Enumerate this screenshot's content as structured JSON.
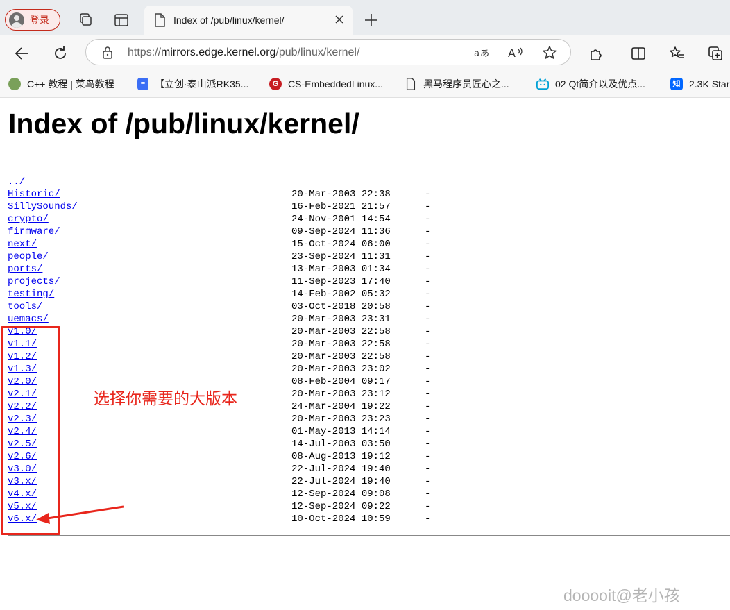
{
  "browser": {
    "profile_label": "登录",
    "tab": {
      "title": "Index of /pub/linux/kernel/"
    },
    "address": {
      "scheme": "https://",
      "host": "mirrors.edge.kernel.org",
      "path": "/pub/linux/kernel/"
    }
  },
  "favorites": [
    {
      "label": "C++ 教程 | 菜鸟教程",
      "icon": "runoob-icon",
      "color": "#6b8e4e"
    },
    {
      "label": "【立创·泰山派RK35...",
      "icon": "doc-icon",
      "color": "#3b6ef5"
    },
    {
      "label": "CS-EmbeddedLinux...",
      "icon": "gitee-icon",
      "color": "#c71d23"
    },
    {
      "label": "黑马程序员匠心之...",
      "icon": "page-icon",
      "color": "#555555"
    },
    {
      "label": "02 Qt简介以及优点...",
      "icon": "bilibili-icon",
      "color": "#00a1d6"
    },
    {
      "label": "2.3K Star",
      "icon": "zhihu-icon",
      "color": "#0066ff"
    }
  ],
  "page": {
    "heading": "Index of /pub/linux/kernel/",
    "entries": [
      {
        "name": "../",
        "date": "",
        "size": ""
      },
      {
        "name": "Historic/",
        "date": "20-Mar-2003 22:38",
        "size": "-"
      },
      {
        "name": "SillySounds/",
        "date": "16-Feb-2021 21:57",
        "size": "-"
      },
      {
        "name": "crypto/",
        "date": "24-Nov-2001 14:54",
        "size": "-"
      },
      {
        "name": "firmware/",
        "date": "09-Sep-2024 11:36",
        "size": "-"
      },
      {
        "name": "next/",
        "date": "15-Oct-2024 06:00",
        "size": "-"
      },
      {
        "name": "people/",
        "date": "23-Sep-2024 11:31",
        "size": "-"
      },
      {
        "name": "ports/",
        "date": "13-Mar-2003 01:34",
        "size": "-"
      },
      {
        "name": "projects/",
        "date": "11-Sep-2023 17:40",
        "size": "-"
      },
      {
        "name": "testing/",
        "date": "14-Feb-2002 05:32",
        "size": "-"
      },
      {
        "name": "tools/",
        "date": "03-Oct-2018 20:58",
        "size": "-"
      },
      {
        "name": "uemacs/",
        "date": "20-Mar-2003 23:31",
        "size": "-"
      },
      {
        "name": "v1.0/",
        "date": "20-Mar-2003 22:58",
        "size": "-"
      },
      {
        "name": "v1.1/",
        "date": "20-Mar-2003 22:58",
        "size": "-"
      },
      {
        "name": "v1.2/",
        "date": "20-Mar-2003 22:58",
        "size": "-"
      },
      {
        "name": "v1.3/",
        "date": "20-Mar-2003 23:02",
        "size": "-"
      },
      {
        "name": "v2.0/",
        "date": "08-Feb-2004 09:17",
        "size": "-"
      },
      {
        "name": "v2.1/",
        "date": "20-Mar-2003 23:12",
        "size": "-"
      },
      {
        "name": "v2.2/",
        "date": "24-Mar-2004 19:22",
        "size": "-"
      },
      {
        "name": "v2.3/",
        "date": "20-Mar-2003 23:23",
        "size": "-"
      },
      {
        "name": "v2.4/",
        "date": "01-May-2013 14:14",
        "size": "-"
      },
      {
        "name": "v2.5/",
        "date": "14-Jul-2003 03:50",
        "size": "-"
      },
      {
        "name": "v2.6/",
        "date": "08-Aug-2013 19:12",
        "size": "-"
      },
      {
        "name": "v3.0/",
        "date": "22-Jul-2024 19:40",
        "size": "-"
      },
      {
        "name": "v3.x/",
        "date": "22-Jul-2024 19:40",
        "size": "-"
      },
      {
        "name": "v4.x/",
        "date": "12-Sep-2024 09:08",
        "size": "-"
      },
      {
        "name": "v5.x/",
        "date": "12-Sep-2024 09:22",
        "size": "-"
      },
      {
        "name": "v6.x/",
        "date": "10-Oct-2024 10:59",
        "size": "-"
      }
    ],
    "annotation_text": "选择你需要的大版本",
    "annotation_color": "#e8261c",
    "watermark": "dooooit@老小孩"
  }
}
